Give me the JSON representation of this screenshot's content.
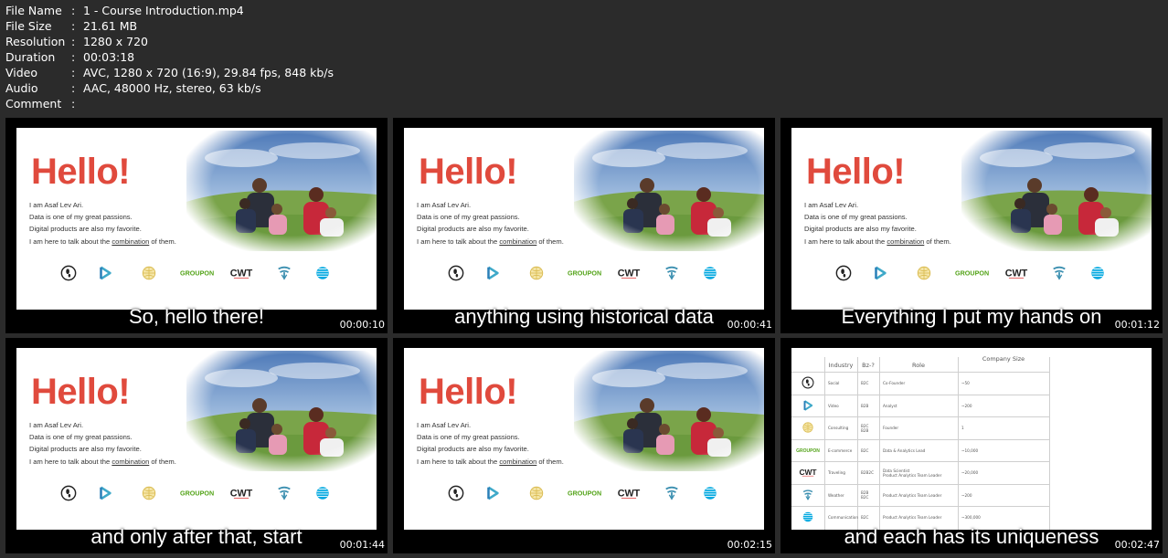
{
  "meta": {
    "separator": ":",
    "rows": [
      {
        "key": "File Name",
        "value": "1 - Course Introduction.mp4"
      },
      {
        "key": "File Size",
        "value": "21.61 MB"
      },
      {
        "key": "Resolution",
        "value": "1280 x 720"
      },
      {
        "key": "Duration",
        "value": "00:03:18"
      },
      {
        "key": "Video",
        "value": "AVC, 1280 x 720 (16:9), 29.84 fps, 848 kb/s"
      },
      {
        "key": "Audio",
        "value": "AAC, 48000 Hz, stereo, 63 kb/s"
      },
      {
        "key": "Comment",
        "value": ""
      }
    ]
  },
  "slide": {
    "hello": "Hello!",
    "bio": [
      "I am Asaf Lev Ari.",
      "Data is one of my great passions.",
      "Digital products are also my favorite."
    ],
    "bio_last_prefix": "I am here to talk about the ",
    "bio_last_link": "combination",
    "bio_last_suffix": " of them.",
    "logos": [
      "feet-logo",
      "play-logo",
      "globe-logo",
      "GROUPON",
      "CWT",
      "weather-logo",
      "att-logo"
    ],
    "groupon_color": "#53a318",
    "hello_color": "#e04a3d"
  },
  "thumbnails": [
    {
      "subtitle": "So, hello there!",
      "time": "00:00:10"
    },
    {
      "subtitle": "anything using historical data",
      "time": "00:00:41"
    },
    {
      "subtitle": "Everything I put my hands on",
      "time": "00:01:12"
    },
    {
      "subtitle": "and only after that, start",
      "time": "00:01:44"
    },
    {
      "subtitle": "",
      "time": "00:02:15"
    },
    {
      "subtitle": "and each has its uniqueness",
      "time": "00:02:47"
    }
  ],
  "table": {
    "headers": [
      "Industry",
      "Bz-?",
      "Role",
      "Company Size"
    ],
    "rows": [
      {
        "logo": "feet-logo",
        "industry": "Social",
        "model": "B2C",
        "role": "Co-Founder",
        "size": "~50"
      },
      {
        "logo": "play-logo",
        "industry": "Video",
        "model": "B2B",
        "role": "Analyst",
        "size": "~200"
      },
      {
        "logo": "globe-logo",
        "industry": "Consulting",
        "model": "B2C\nB2B",
        "role": "Founder",
        "size": "1"
      },
      {
        "logo": "GROUPON",
        "industry": "E-commerce",
        "model": "B2C",
        "role": "Data & Analytics Lead",
        "size": "~10,000"
      },
      {
        "logo": "CWT",
        "industry": "Traveling",
        "model": "B2B2C",
        "role": "Data Scientist\nProduct Analytics Team Leader",
        "size": "~20,000"
      },
      {
        "logo": "weather-logo",
        "industry": "Weather",
        "model": "B2B\nB2C",
        "role": "Product Analytics Team Leader",
        "size": "~200"
      },
      {
        "logo": "att-logo",
        "industry": "Communication",
        "model": "B2C",
        "role": "Product Analytics Team Leader",
        "size": "~300,000"
      }
    ]
  }
}
